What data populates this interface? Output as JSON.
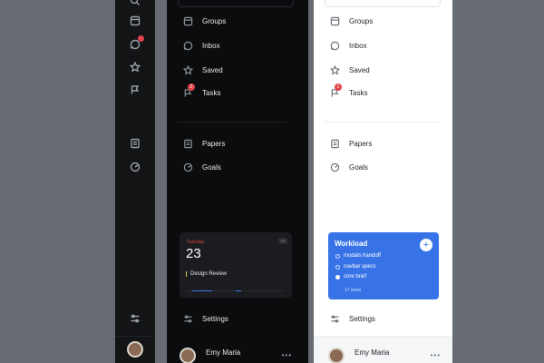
{
  "colors": {
    "accent": "#3773e6",
    "badge": "#e0444a",
    "dark_bg": "#0b0c0d",
    "light_bg": "#ffffff"
  },
  "rail": {
    "icons": [
      "search-icon",
      "archive-icon",
      "chat-icon",
      "star-icon",
      "flag-icon",
      "document-icon",
      "target-icon",
      "settings-icon"
    ]
  },
  "nav": {
    "items": [
      {
        "label": "Groups",
        "icon": "archive-icon"
      },
      {
        "label": "Inbox",
        "icon": "chat-icon"
      },
      {
        "label": "Saved",
        "icon": "star-icon"
      },
      {
        "label": "Tasks",
        "icon": "flag-icon",
        "badge": "2"
      },
      {
        "label": "Papers",
        "icon": "document-icon"
      },
      {
        "label": "Goals",
        "icon": "target-icon"
      },
      {
        "label": "Settings",
        "icon": "settings-icon"
      }
    ]
  },
  "calendar": {
    "day": "Tuesday",
    "date": "23",
    "badge": "2/7",
    "event": "Design Review"
  },
  "workload": {
    "title": "Workload",
    "tasks": [
      {
        "label": "modals handoff",
        "done": false
      },
      {
        "label": "navbar specs",
        "done": false
      },
      {
        "label": "core brief",
        "done": true
      }
    ],
    "more": "17 more"
  },
  "user": {
    "name": "Emy Maria"
  }
}
